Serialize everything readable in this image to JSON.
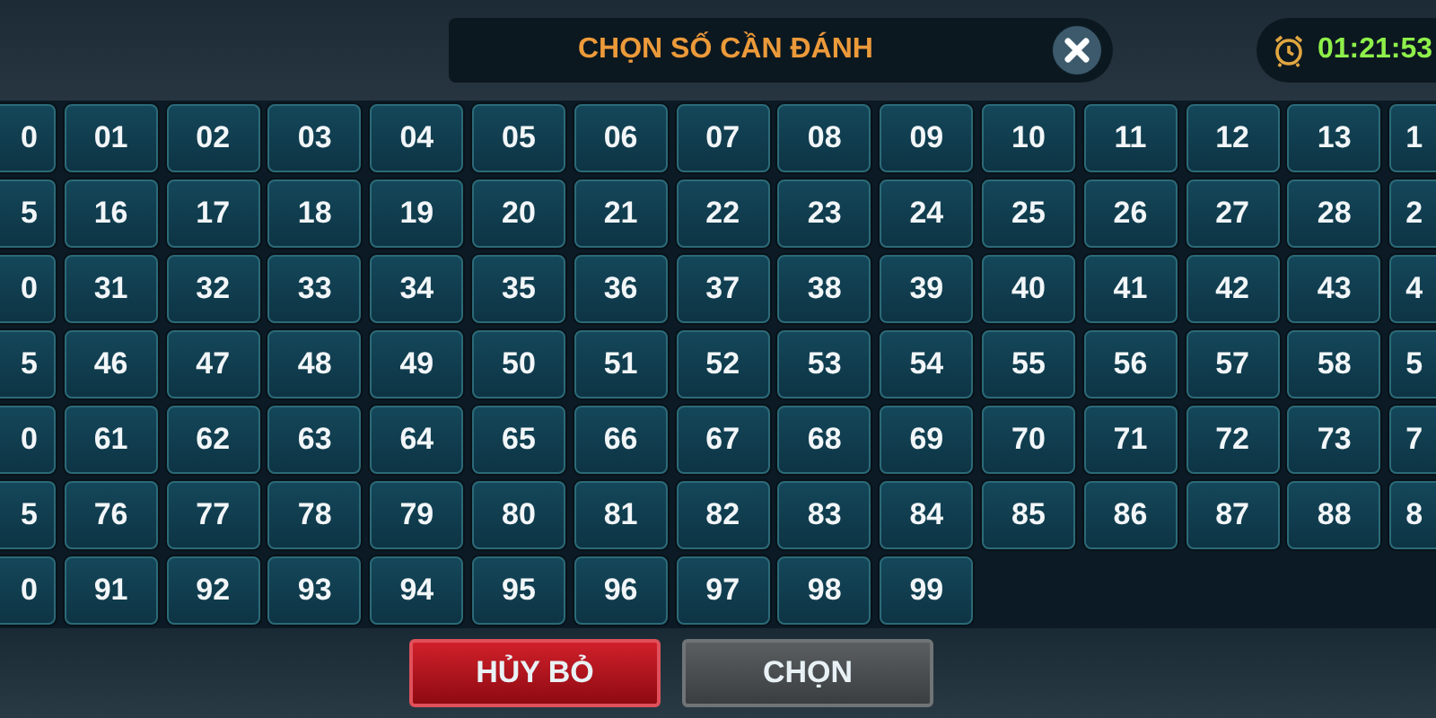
{
  "header": {
    "title": "CHỌN SỐ CẦN ĐÁNH",
    "timer": "01:21:53"
  },
  "grid": {
    "rows": [
      [
        "0",
        "01",
        "02",
        "03",
        "04",
        "05",
        "06",
        "07",
        "08",
        "09",
        "10",
        "11",
        "12",
        "13",
        "1"
      ],
      [
        "5",
        "16",
        "17",
        "18",
        "19",
        "20",
        "21",
        "22",
        "23",
        "24",
        "25",
        "26",
        "27",
        "28",
        "2"
      ],
      [
        "0",
        "31",
        "32",
        "33",
        "34",
        "35",
        "36",
        "37",
        "38",
        "39",
        "40",
        "41",
        "42",
        "43",
        "4"
      ],
      [
        "5",
        "46",
        "47",
        "48",
        "49",
        "50",
        "51",
        "52",
        "53",
        "54",
        "55",
        "56",
        "57",
        "58",
        "5"
      ],
      [
        "0",
        "61",
        "62",
        "63",
        "64",
        "65",
        "66",
        "67",
        "68",
        "69",
        "70",
        "71",
        "72",
        "73",
        "7"
      ],
      [
        "5",
        "76",
        "77",
        "78",
        "79",
        "80",
        "81",
        "82",
        "83",
        "84",
        "85",
        "86",
        "87",
        "88",
        "8"
      ],
      [
        "0",
        "91",
        "92",
        "93",
        "94",
        "95",
        "96",
        "97",
        "98",
        "99"
      ]
    ]
  },
  "buttons": [
    {
      "label": "HỦY BỎ",
      "kind": "cancel"
    },
    {
      "label": "CHỌN",
      "kind": "confirm"
    }
  ]
}
